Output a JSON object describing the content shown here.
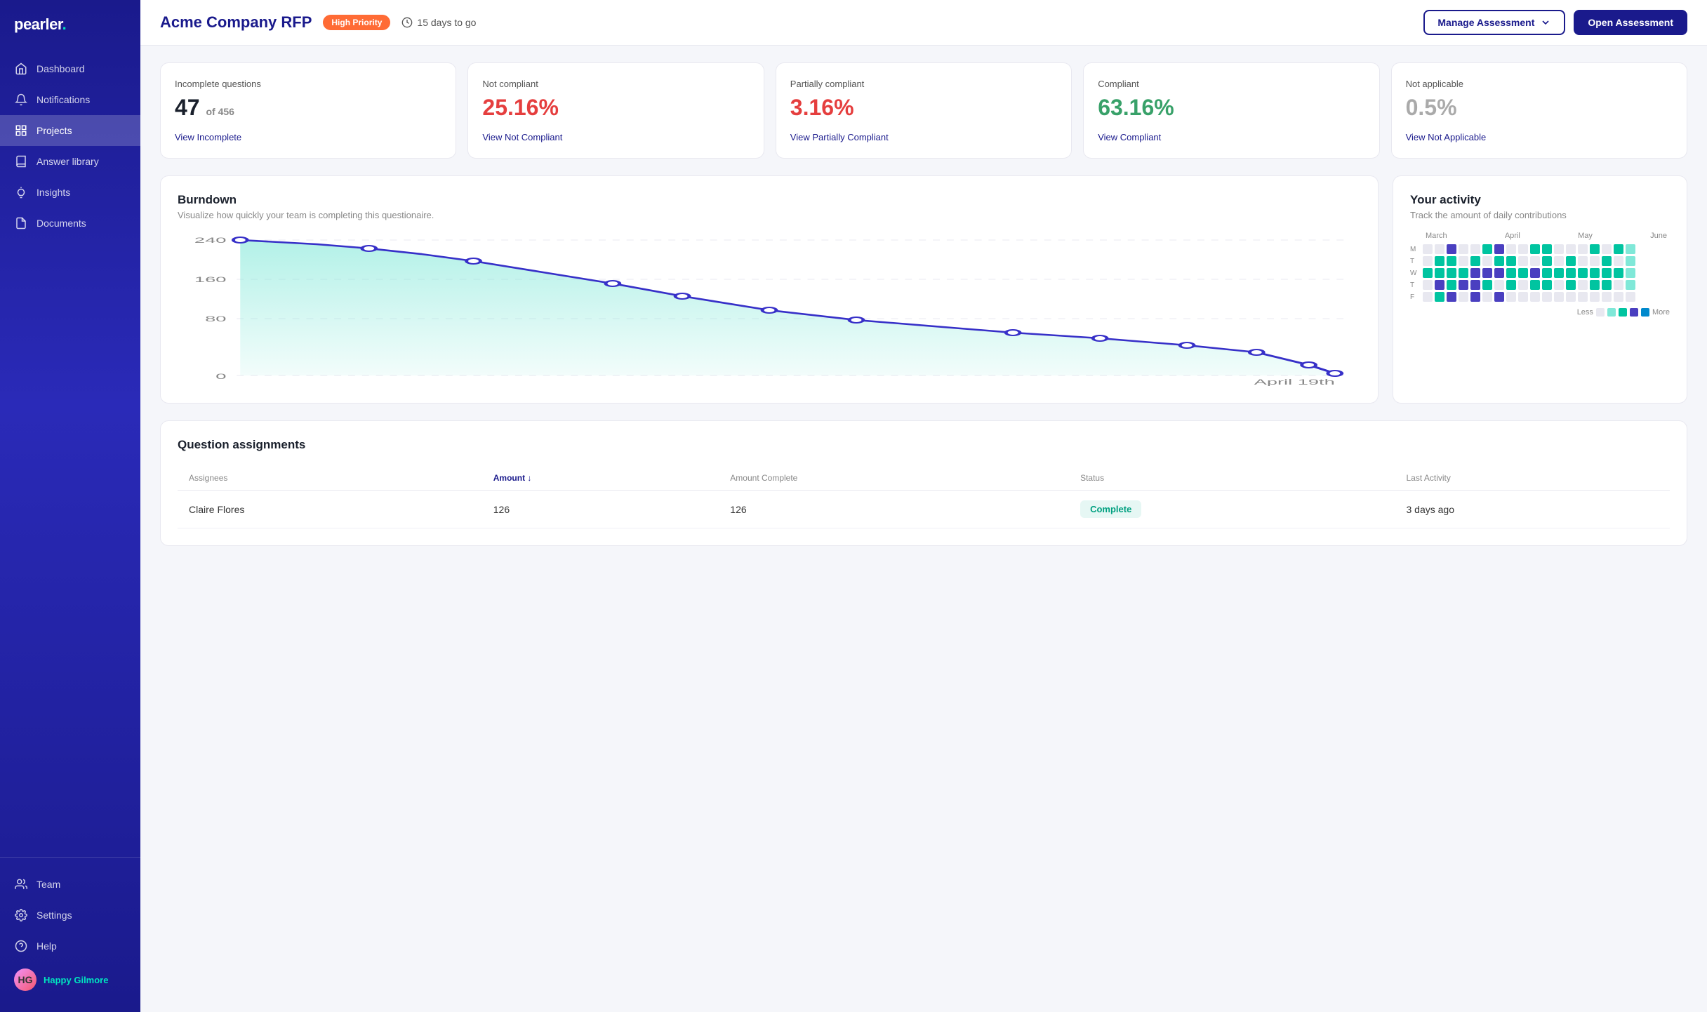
{
  "app": {
    "logo": "pearler.",
    "logo_dot_color": "#00e5c0"
  },
  "sidebar": {
    "items": [
      {
        "id": "dashboard",
        "label": "Dashboard",
        "icon": "home",
        "active": false
      },
      {
        "id": "notifications",
        "label": "Notifications",
        "icon": "bell",
        "active": false
      },
      {
        "id": "projects",
        "label": "Projects",
        "icon": "grid",
        "active": true
      },
      {
        "id": "answer-library",
        "label": "Answer library",
        "icon": "book",
        "active": false
      },
      {
        "id": "insights",
        "label": "Insights",
        "icon": "lightbulb",
        "active": false
      },
      {
        "id": "documents",
        "label": "Documents",
        "icon": "file",
        "active": false
      }
    ],
    "bottom_items": [
      {
        "id": "team",
        "label": "Team",
        "icon": "users"
      },
      {
        "id": "settings",
        "label": "Settings",
        "icon": "gear"
      },
      {
        "id": "help",
        "label": "Help",
        "icon": "help"
      }
    ],
    "user": {
      "name": "Happy Gilmore",
      "initials": "HG"
    }
  },
  "header": {
    "title": "Acme Company RFP",
    "priority_badge": "High Priority",
    "days_to_go": "15 days to go",
    "manage_button": "Manage Assessment",
    "open_button": "Open Assessment"
  },
  "stats": [
    {
      "title": "Incomplete questions",
      "value": "47",
      "sub": "of 456",
      "link": "View Incomplete",
      "value_color": "dark"
    },
    {
      "title": "Not compliant",
      "value": "25.16%",
      "sub": "",
      "link": "View Not Compliant",
      "value_color": "red"
    },
    {
      "title": "Partially compliant",
      "value": "3.16%",
      "sub": "",
      "link": "View Partially Compliant",
      "value_color": "red"
    },
    {
      "title": "Compliant",
      "value": "63.16%",
      "sub": "",
      "link": "View Compliant",
      "value_color": "green"
    },
    {
      "title": "Not applicable",
      "value": "0.5%",
      "sub": "",
      "link": "View Not Applicable",
      "value_color": "gray"
    }
  ],
  "burndown": {
    "title": "Burndown",
    "subtitle": "Visualize how quickly your team is completing this questionaire.",
    "date_label": "April 19th",
    "y_labels": [
      "240",
      "160",
      "80",
      "0"
    ],
    "y_values": [
      240,
      160,
      80,
      0
    ]
  },
  "activity": {
    "title": "Your activity",
    "subtitle": "Track the amount of daily contributions",
    "months": [
      "March",
      "April",
      "May",
      "June"
    ],
    "day_labels": [
      "M",
      "T",
      "W",
      "T",
      "F"
    ],
    "legend": {
      "less": "Less",
      "more": "More"
    }
  },
  "assignments": {
    "title": "Question assignments",
    "columns": [
      {
        "key": "assignee",
        "label": "Assignees"
      },
      {
        "key": "amount",
        "label": "Amount",
        "sortable": true
      },
      {
        "key": "amount_complete",
        "label": "Amount Complete"
      },
      {
        "key": "status",
        "label": "Status"
      },
      {
        "key": "last_activity",
        "label": "Last Activity"
      }
    ],
    "rows": [
      {
        "assignee": "Claire Flores",
        "amount": "126",
        "amount_complete": "126",
        "status": "Complete",
        "last_activity": "3 days ago"
      }
    ]
  }
}
